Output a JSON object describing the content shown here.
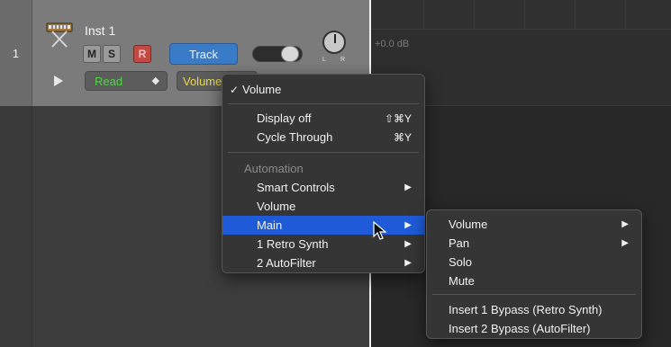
{
  "track": {
    "number": "1",
    "name": "Inst 1",
    "mute_label": "M",
    "solo_label": "S",
    "record_label": "R",
    "track_button_label": "Track",
    "pan_left_label": "L",
    "pan_right_label": "R",
    "automation_mode": "Read",
    "automation_param": "Volume",
    "volume_level": 0.72
  },
  "arrange": {
    "db_readout": "+0.0 dB"
  },
  "main_menu": {
    "checked_item": "Volume",
    "items": [
      {
        "label": "Display off",
        "shortcut": "⇧⌘Y"
      },
      {
        "label": "Cycle Through",
        "shortcut": "⌘Y"
      }
    ],
    "section_label": "Automation",
    "automation_items": [
      {
        "label": "Smart Controls",
        "has_submenu": true
      },
      {
        "label": "Volume",
        "has_submenu": false
      },
      {
        "label": "Main",
        "has_submenu": true,
        "highlighted": true
      },
      {
        "label": "1 Retro Synth",
        "has_submenu": true
      },
      {
        "label": "2 AutoFilter",
        "has_submenu": true
      }
    ]
  },
  "sub_menu": {
    "items": [
      {
        "label": "Volume",
        "has_submenu": true
      },
      {
        "label": "Pan",
        "has_submenu": true
      },
      {
        "label": "Solo",
        "has_submenu": false
      },
      {
        "label": "Mute",
        "has_submenu": false
      }
    ],
    "bypass_items": [
      {
        "label": "Insert 1 Bypass (Retro Synth)"
      },
      {
        "label": "Insert 2 Bypass (AutoFilter)"
      }
    ]
  },
  "icons": {
    "instrument": "synth-keyboard-icon",
    "play": "play-icon",
    "submenu_arrow": "submenu-arrow-icon",
    "cursor": "mouse-pointer-icon"
  },
  "colors": {
    "highlight": "#1f5bd8",
    "track_button": "#3a7bc8",
    "record": "#c34a43",
    "read_mode": "#55d24a",
    "automation_param": "#e8d852"
  }
}
